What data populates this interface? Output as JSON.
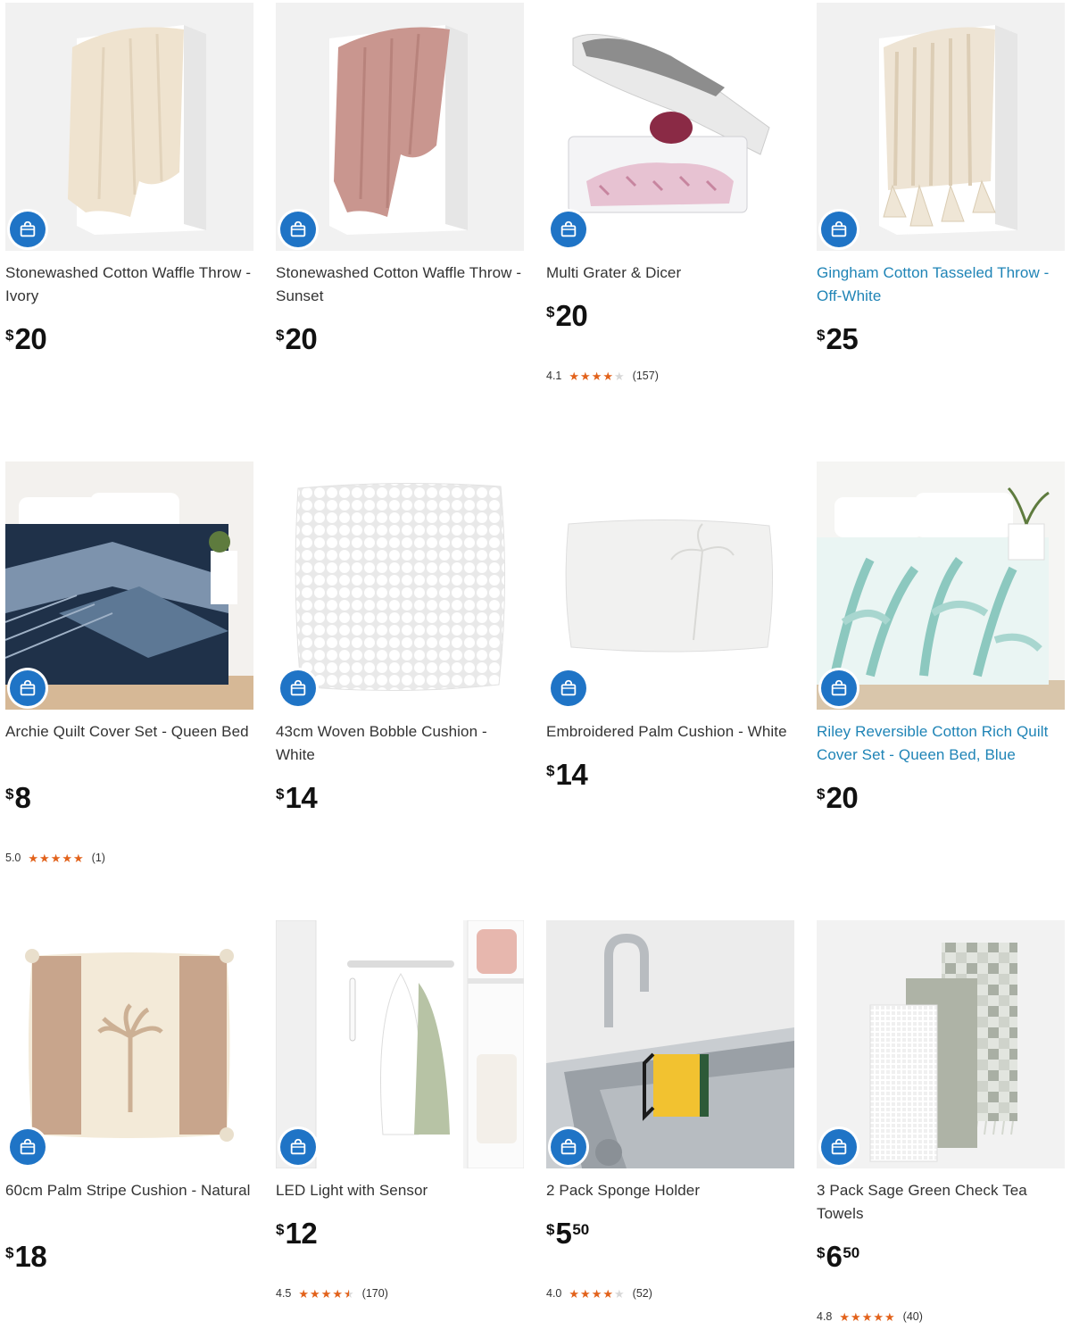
{
  "products": [
    {
      "name": "Stonewashed Cotton Waffle Throw - Ivory",
      "currency": "$",
      "price": "20",
      "cents": "",
      "icon": "shopping-bag-icon"
    },
    {
      "name": "Stonewashed Cotton Waffle Throw - Sunset",
      "currency": "$",
      "price": "20",
      "cents": "",
      "icon": "shopping-bag-icon"
    },
    {
      "name": "Multi Grater & Dicer",
      "currency": "$",
      "price": "20",
      "cents": "",
      "rating": "4.1",
      "stars": 4.1,
      "reviews": "(157)",
      "icon": "shopping-bag-icon"
    },
    {
      "name": "Gingham Cotton Tasseled Throw - Off-White",
      "currency": "$",
      "price": "25",
      "cents": "",
      "icon": "shopping-bag-icon"
    },
    {
      "name": "Archie Quilt Cover Set - Queen Bed",
      "currency": "$",
      "price": "8",
      "cents": "",
      "rating": "5.0",
      "stars": 5.0,
      "reviews": "(1)",
      "icon": "shopping-bag-icon"
    },
    {
      "name": "43cm Woven Bobble Cushion - White",
      "currency": "$",
      "price": "14",
      "cents": "",
      "icon": "shopping-bag-icon"
    },
    {
      "name": "Embroidered Palm Cushion - White",
      "currency": "$",
      "price": "14",
      "cents": "",
      "icon": "shopping-bag-icon"
    },
    {
      "name": "Riley Reversible Cotton Rich Quilt Cover Set - Queen Bed, Blue",
      "currency": "$",
      "price": "20",
      "cents": "",
      "icon": "shopping-bag-icon"
    },
    {
      "name": "60cm Palm Stripe Cushion - Natural",
      "currency": "$",
      "price": "18",
      "cents": "",
      "icon": "shopping-bag-icon"
    },
    {
      "name": "LED Light with Sensor",
      "currency": "$",
      "price": "12",
      "cents": "",
      "rating": "4.5",
      "stars": 4.5,
      "reviews": "(170)",
      "icon": "shopping-bag-icon"
    },
    {
      "name": "2 Pack Sponge Holder",
      "currency": "$",
      "price": "5",
      "cents": "50",
      "rating": "4.0",
      "stars": 4.0,
      "reviews": "(52)",
      "icon": "shopping-bag-icon"
    },
    {
      "name": "3 Pack Sage Green Check Tea Towels",
      "currency": "$",
      "price": "6",
      "cents": "50",
      "rating": "4.8",
      "stars": 4.8,
      "reviews": "(40)",
      "icon": "shopping-bag-icon"
    }
  ],
  "colors": {
    "accent": "#1f74c6",
    "star": "#e2621b",
    "link": "#1f84b6"
  }
}
